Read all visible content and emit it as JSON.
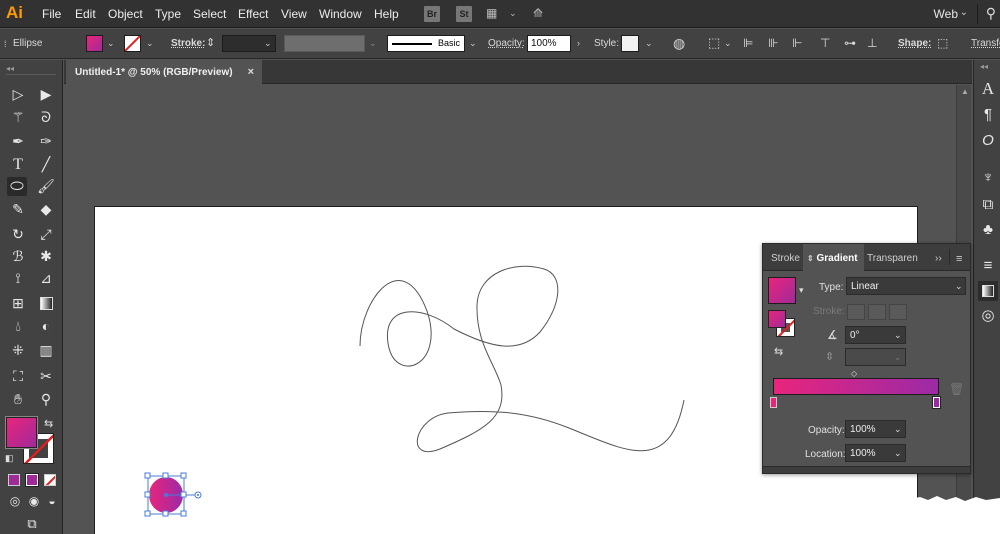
{
  "app": {
    "logo": "Ai"
  },
  "menu": [
    "File",
    "Edit",
    "Object",
    "Type",
    "Select",
    "Effect",
    "View",
    "Window",
    "Help"
  ],
  "menubar_badges": {
    "bridge": "Br",
    "stock": "St"
  },
  "workspace": {
    "label": "Web"
  },
  "control_bar": {
    "object_type": "Ellipse",
    "stroke_label": "Stroke:",
    "brush_name": "Basic",
    "opacity_label": "Opacity:",
    "opacity_value": "100%",
    "style_label": "Style:",
    "shape_label": "Shape:",
    "transform_label": "Transfo"
  },
  "document": {
    "tab_title": "Untitled-1* @ 50% (RGB/Preview)",
    "close_glyph": "×"
  },
  "gradient_panel": {
    "tabs": [
      "Stroke",
      "Gradient",
      "Transparen"
    ],
    "active_tab": "Gradient",
    "type_label": "Type:",
    "type_value": "Linear",
    "stroke_label": "Stroke:",
    "angle_value": "0°",
    "opacity_label": "Opacity:",
    "opacity_value": "100%",
    "location_label": "Location:",
    "location_value": "100%"
  },
  "colors": {
    "gradient_start": "#e8257c",
    "gradient_end": "#9b2aa6",
    "accent_logo": "#ff9a00",
    "ui_dark": "#323232",
    "ui_panel": "#424242",
    "canvas_bg": "#535353",
    "artboard": "#ffffff"
  }
}
